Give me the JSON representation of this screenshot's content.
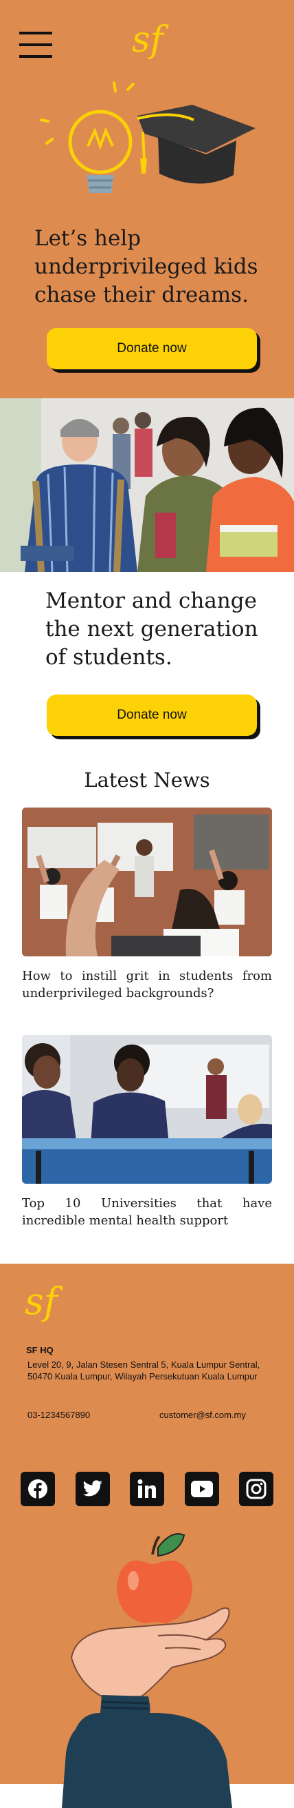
{
  "brand": {
    "logo_text": "sf",
    "logo_color": "#FCD106",
    "primary_bg": "#DE8B50",
    "accent": "#FCD106"
  },
  "header": {
    "menu_icon": "hamburger-icon"
  },
  "hero": {
    "headline": "Let’s help underprivileged kids chase their dreams.",
    "cta_label": "Donate now"
  },
  "mentor": {
    "headline": "Mentor and change the next generation of students.",
    "cta_label": "Donate now"
  },
  "news": {
    "title": "Latest News",
    "items": [
      {
        "title": "How to instill grit in students from underprivileged backgrounds?"
      },
      {
        "title": "Top 10 Universities that have incredible mental health support"
      }
    ]
  },
  "footer": {
    "hq_label": "SF HQ",
    "address": "Level 20, 9, Jalan Stesen Sentral 5, Kuala Lumpur Sentral, 50470 Kuala Lumpur, Wilayah Persekutuan Kuala Lumpur",
    "phone": "03-1234567890",
    "email": "customer@sf.com.my",
    "social": [
      "facebook-icon",
      "twitter-icon",
      "linkedin-icon",
      "youtube-icon",
      "instagram-icon"
    ]
  }
}
